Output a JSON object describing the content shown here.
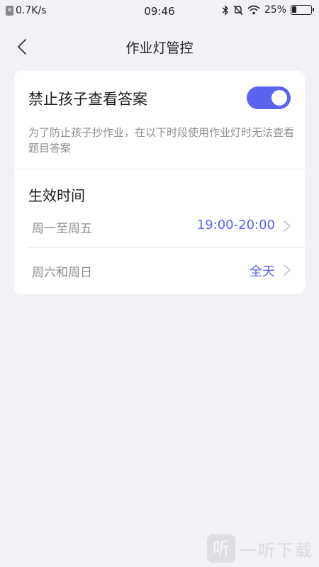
{
  "status_bar": {
    "network_speed": "0.7K/s",
    "time": "09:46",
    "battery_percent": "25%",
    "battery_level": 0.25,
    "notification_icon": "x-icon"
  },
  "nav": {
    "title": "作业灯管控",
    "back_icon": "chevron-left-icon"
  },
  "card": {
    "switch_label": "禁止孩子查看答案",
    "switch_on": true,
    "switch_description": "为了防止孩子抄作业，在以下时段使用作业灯时无法查看题目答案",
    "section_title": "生效时间",
    "schedule": [
      {
        "label": "周一至周五",
        "value": "19:00-20:00"
      },
      {
        "label": "周六和周日",
        "value": "全天"
      }
    ]
  },
  "watermark": {
    "logo_glyph": "听",
    "text": "一听下载"
  },
  "colors": {
    "accent": "#5c63f0",
    "background": "#f1f1f6",
    "card": "#ffffff",
    "secondary_text": "#8e8e93"
  }
}
